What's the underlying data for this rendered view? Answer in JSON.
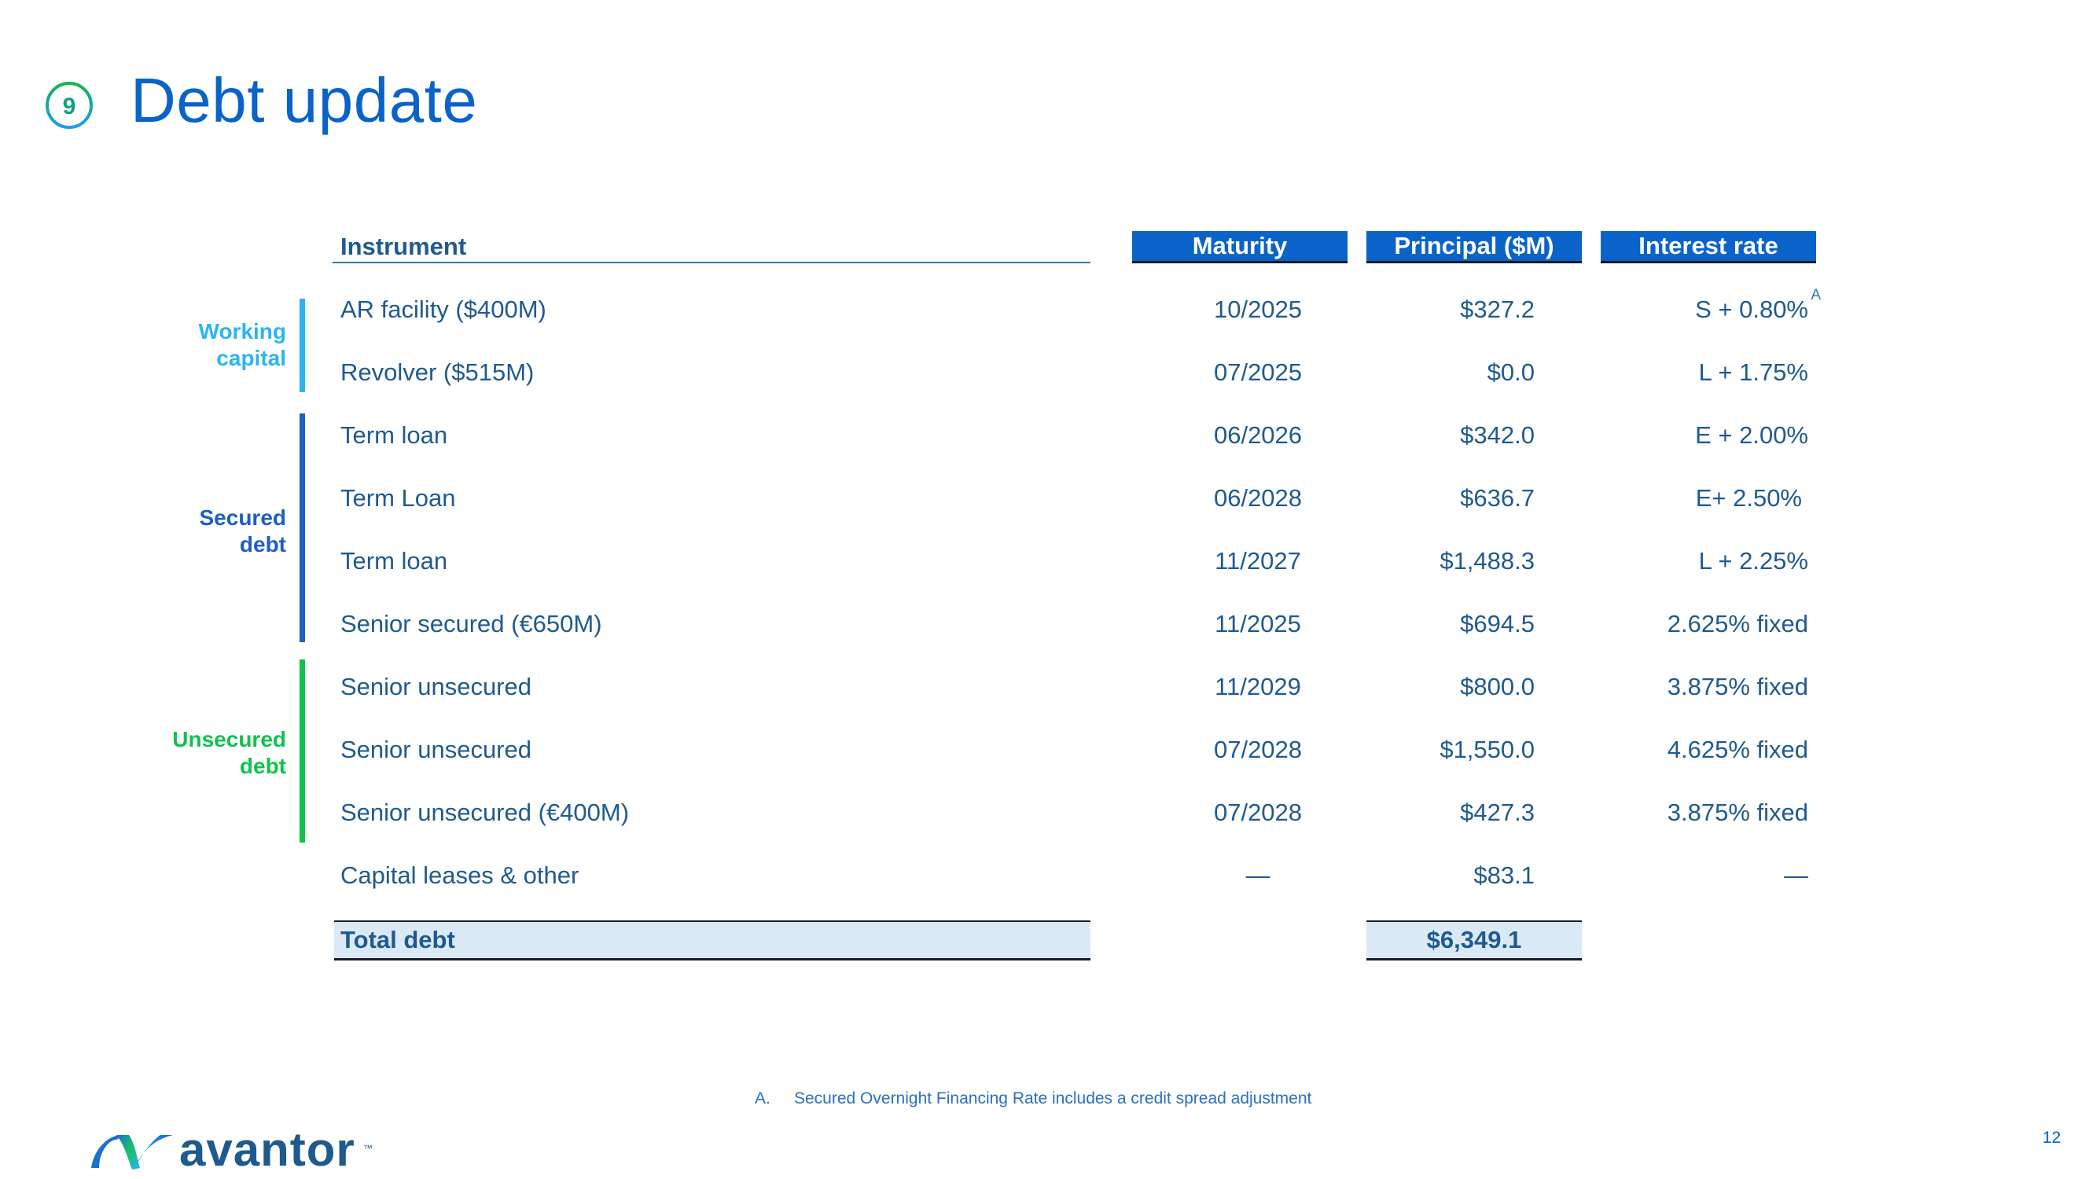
{
  "header": {
    "section_number": "9",
    "title": "Debt update"
  },
  "table": {
    "columns": {
      "instrument": "Instrument",
      "maturity": "Maturity",
      "principal": "Principal ($M)",
      "interest_rate": "Interest rate"
    },
    "groups": [
      {
        "label_line1": "Working",
        "label_line2": "capital",
        "color": "#2bb5f0",
        "rows": [
          0,
          1
        ]
      },
      {
        "label_line1": "Secured",
        "label_line2": "debt",
        "color": "#1c5fc4",
        "rows": [
          2,
          3,
          4,
          5
        ]
      },
      {
        "label_line1": "Unsecured",
        "label_line2": "debt",
        "color": "#10c24c",
        "rows": [
          6,
          7,
          8
        ]
      }
    ],
    "rows": [
      {
        "instrument": "AR facility ($400M)",
        "maturity": "10/2025",
        "principal": "$327.2",
        "interest_rate": "S + 0.80%",
        "footnote_ref": "A"
      },
      {
        "instrument": "Revolver ($515M)",
        "maturity": "07/2025",
        "principal": "$0.0",
        "interest_rate": "L + 1.75%"
      },
      {
        "instrument": "Term loan",
        "maturity": "06/2026",
        "principal": "$342.0",
        "interest_rate": "E + 2.00%"
      },
      {
        "instrument": "Term Loan",
        "maturity": "06/2028",
        "principal": "$636.7",
        "interest_rate": "E+ 2.50%"
      },
      {
        "instrument": "Term loan",
        "maturity": "11/2027",
        "principal": "$1,488.3",
        "interest_rate": "L + 2.25%"
      },
      {
        "instrument": "Senior secured (€650M)",
        "maturity": "11/2025",
        "principal": "$694.5",
        "interest_rate": "2.625% fixed"
      },
      {
        "instrument": "Senior unsecured",
        "maturity": "11/2029",
        "principal": "$800.0",
        "interest_rate": "3.875% fixed"
      },
      {
        "instrument": "Senior unsecured",
        "maturity": "07/2028",
        "principal": "$1,550.0",
        "interest_rate": "4.625% fixed"
      },
      {
        "instrument": "Senior unsecured (€400M)",
        "maturity": "07/2028",
        "principal": "$427.3",
        "interest_rate": "3.875% fixed"
      },
      {
        "instrument": "Capital leases & other",
        "maturity": "—",
        "principal": "$83.1",
        "interest_rate": "—"
      }
    ],
    "total": {
      "label": "Total debt",
      "principal": "$6,349.1"
    }
  },
  "footnote": {
    "letter": "A.",
    "text": "Secured Overnight Financing Rate includes a credit spread adjustment"
  },
  "footer": {
    "brand": "avantor",
    "trademark": "™",
    "page_number": "12"
  },
  "colors": {
    "brand_blue": "#0a63c9",
    "text_navy": "#1f5a8f",
    "working_capital": "#2bb5f0",
    "secured": "#1c5fc4",
    "unsecured": "#10c24c",
    "total_fill": "#dbe9f6"
  }
}
